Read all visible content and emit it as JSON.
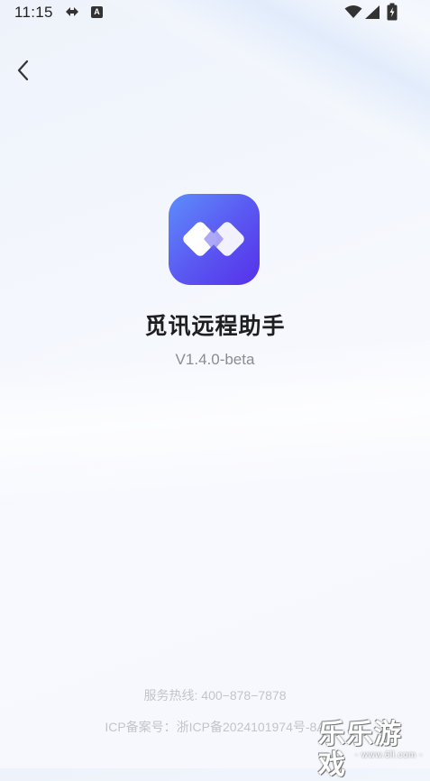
{
  "status_bar": {
    "time": "11:15",
    "icons": [
      "sync-icon",
      "a-badge-icon",
      "wifi-icon",
      "signal-icon",
      "battery-charging-icon"
    ],
    "a_badge": "A"
  },
  "nav": {
    "back_icon": "chevron-left-icon"
  },
  "app": {
    "icon": "two-diamonds-logo-icon",
    "icon_colors": [
      "#5d8dfb",
      "#5630ea"
    ],
    "name": "觅讯远程助手",
    "version": "V1.4.0-beta"
  },
  "footer": {
    "hotline": "服务热线: 400−878−7878",
    "icp": "ICP备案号：浙ICP备2024101974号-8A"
  },
  "watermark": {
    "title": "乐乐游戏",
    "url": "- www.6ll.com -"
  },
  "colors": {
    "accent": "#5a55f1",
    "text_primary": "#1f1f1f",
    "text_secondary": "#8a8c90",
    "text_muted": "#c2c4c8"
  }
}
